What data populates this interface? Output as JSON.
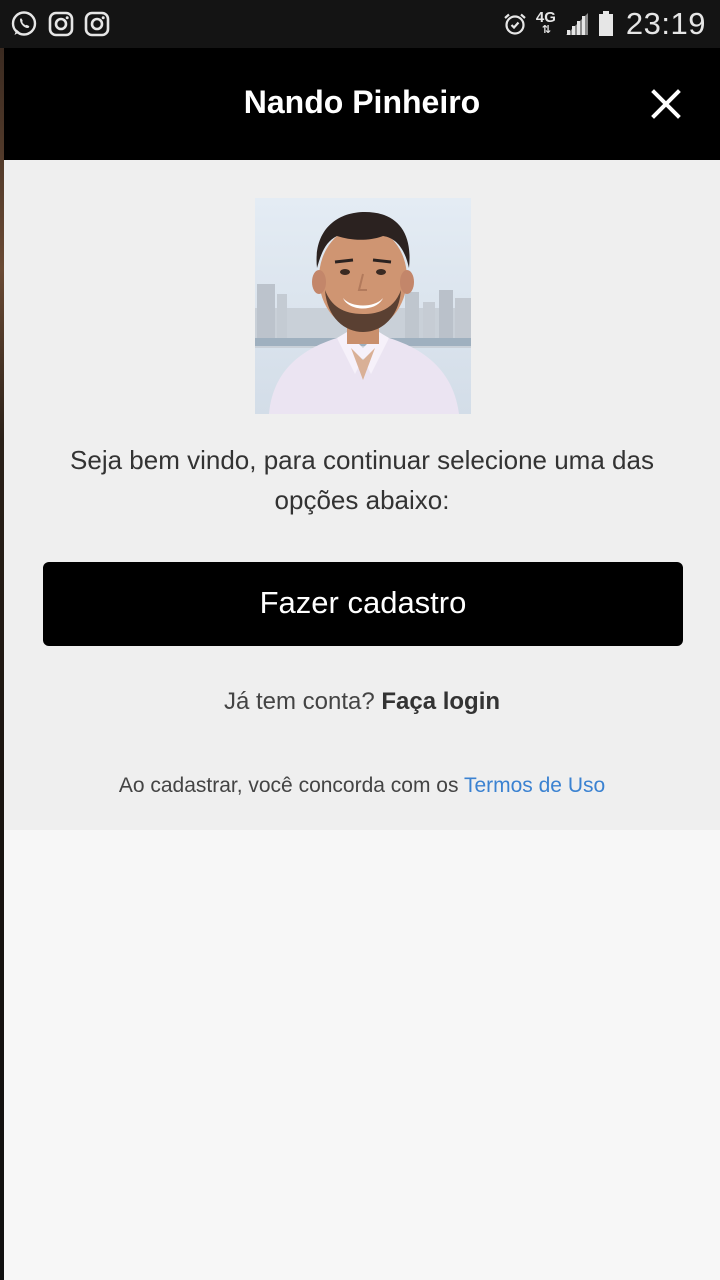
{
  "status_bar": {
    "left_icons": [
      "whatsapp-icon",
      "instagram-icon",
      "instagram-icon"
    ],
    "right_icons": [
      "alarm-icon",
      "4g-icon",
      "signal-icon",
      "battery-icon"
    ],
    "network": "4G",
    "time": "23:19"
  },
  "modal": {
    "title": "Nando Pinheiro",
    "close_icon": "close-icon",
    "avatar_alt": "Nando Pinheiro",
    "welcome": "Seja bem vindo, para continuar selecione uma das opções abaixo:",
    "signup_button": "Fazer cadastro",
    "login_prompt": "Já tem conta?",
    "login_link": "Faça login",
    "terms_prefix": "Ao cadastrar, você concorda com os",
    "terms_link": "Termos de Uso"
  },
  "colors": {
    "header_bg": "#000000",
    "body_bg": "#efefef",
    "button_bg": "#000000",
    "link": "#3b82d1"
  }
}
